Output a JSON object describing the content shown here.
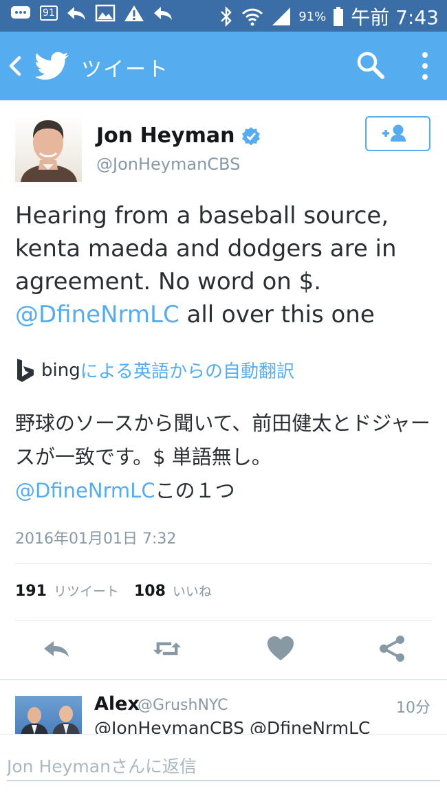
{
  "colors": {
    "statusbar": "#3b6ea6",
    "appbar": "#55acee",
    "link": "#55acee",
    "muted": "#8899a6"
  },
  "statusbar": {
    "notification_badge": "91",
    "battery": "91%",
    "clock": "午前 7:43",
    "icons": [
      "message-icon",
      "badge-icon",
      "reply-icon",
      "image-icon",
      "warning-icon",
      "reply-icon",
      "bluetooth-icon",
      "wifi-icon",
      "signal-icon",
      "battery-icon"
    ]
  },
  "appbar": {
    "title": "ツイート"
  },
  "tweet": {
    "name": "Jon Heyman",
    "handle": "@JonHeymanCBS",
    "text_before": "Hearing from a baseball source, kenta maeda and dodgers are in agreement. No word on $. ",
    "mention": "@DfineNrmLC",
    "text_after": " all over this one",
    "translation": {
      "bing_label": "bing",
      "link": "による英語からの自動翻訳",
      "text": "野球のソースから聞いて、前田健太とドジャースが一致です。$ 単語無し。",
      "mention": "@DfineNrmLC",
      "text_after": "この１つ"
    },
    "timestamp": "2016年01月01日 7:32",
    "retweets": "191",
    "retweets_label": "リツイート",
    "likes": "108",
    "likes_label": "いいね"
  },
  "reply": {
    "name": "Alex",
    "handle": "@GrushNYC",
    "time": "10分",
    "text": "@JonHeymanCBS @DfineNrmLC"
  },
  "composer": {
    "placeholder": "Jon Heymanさんに返信"
  }
}
